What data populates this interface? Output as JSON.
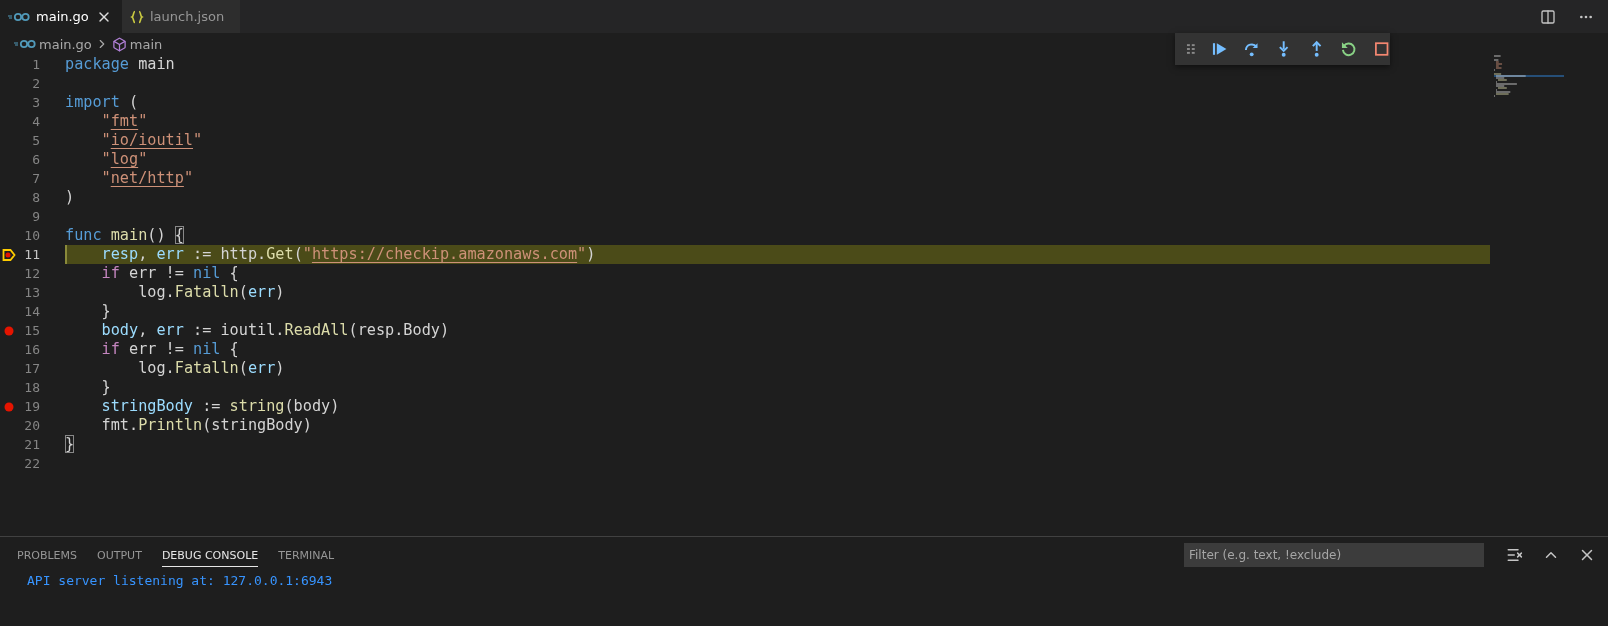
{
  "tabs": [
    {
      "label": "main.go",
      "kind": "go",
      "selected": true
    },
    {
      "label": "launch.json",
      "kind": "json",
      "selected": false
    }
  ],
  "breadcrumbs": [
    {
      "label": "main.go",
      "kind": "go"
    },
    {
      "label": "main",
      "kind": "symbol"
    }
  ],
  "debug_toolbar": [
    {
      "kind": "grip"
    },
    {
      "kind": "continue"
    },
    {
      "kind": "step_over"
    },
    {
      "kind": "step_into"
    },
    {
      "kind": "step_out"
    },
    {
      "kind": "restart"
    },
    {
      "kind": "stop"
    }
  ],
  "code_lines": [
    {
      "number": "1",
      "breakpoint": false,
      "current": false,
      "tokens": [
        {
          "text": "package",
          "kind": "keyword"
        },
        {
          "text": " main",
          "kind": "plain"
        }
      ]
    },
    {
      "number": "2",
      "breakpoint": false,
      "current": false
    },
    {
      "number": "3",
      "breakpoint": false,
      "current": false,
      "tokens": [
        {
          "text": "import",
          "kind": "keyword"
        },
        {
          "text": " (",
          "kind": "plain"
        }
      ]
    },
    {
      "number": "4",
      "breakpoint": false,
      "current": false,
      "tokens": [
        {
          "text": "    \"",
          "kind": "string"
        },
        {
          "text": "fmt",
          "kind": "link"
        },
        {
          "text": "\"",
          "kind": "string"
        }
      ]
    },
    {
      "number": "5",
      "breakpoint": false,
      "current": false,
      "tokens": [
        {
          "text": "    \"",
          "kind": "string"
        },
        {
          "text": "io/ioutil",
          "kind": "link"
        },
        {
          "text": "\"",
          "kind": "string"
        }
      ]
    },
    {
      "number": "6",
      "breakpoint": false,
      "current": false,
      "tokens": [
        {
          "text": "    \"",
          "kind": "string"
        },
        {
          "text": "log",
          "kind": "link"
        },
        {
          "text": "\"",
          "kind": "string"
        }
      ]
    },
    {
      "number": "7",
      "breakpoint": false,
      "current": false,
      "tokens": [
        {
          "text": "    \"",
          "kind": "string"
        },
        {
          "text": "net/http",
          "kind": "link"
        },
        {
          "text": "\"",
          "kind": "string"
        }
      ]
    },
    {
      "number": "8",
      "breakpoint": false,
      "current": false,
      "tokens": [
        {
          "text": ")",
          "kind": "plain"
        }
      ]
    },
    {
      "number": "9",
      "breakpoint": false,
      "current": false
    },
    {
      "number": "10",
      "breakpoint": false,
      "current": false,
      "tokens": [
        {
          "text": "func",
          "kind": "keyword"
        },
        {
          "text": " main",
          "kind": "function"
        },
        {
          "text": "() ",
          "kind": "plain"
        },
        {
          "text": "{",
          "kind": "bracket_match"
        }
      ]
    },
    {
      "number": "11",
      "breakpoint": true,
      "current": true,
      "tokens": [
        {
          "text": "    resp",
          "kind": "variable"
        },
        {
          "text": ", ",
          "kind": "plain"
        },
        {
          "text": "err",
          "kind": "variable"
        },
        {
          "text": " := http.",
          "kind": "plain"
        },
        {
          "text": "Get",
          "kind": "function"
        },
        {
          "text": "(",
          "kind": "plain"
        },
        {
          "text": "\"",
          "kind": "string"
        },
        {
          "text": "https://checkip.amazonaws.com",
          "kind": "link"
        },
        {
          "text": "\"",
          "kind": "string"
        },
        {
          "text": ")",
          "kind": "plain"
        }
      ]
    },
    {
      "number": "12",
      "breakpoint": false,
      "current": false,
      "tokens": [
        {
          "text": "    if",
          "kind": "control"
        },
        {
          "text": " err != ",
          "kind": "plain"
        },
        {
          "text": "nil",
          "kind": "keyword"
        },
        {
          "text": " {",
          "kind": "plain"
        }
      ]
    },
    {
      "number": "13",
      "breakpoint": false,
      "current": false,
      "tokens": [
        {
          "text": "        log.",
          "kind": "plain"
        },
        {
          "text": "Fatalln",
          "kind": "function"
        },
        {
          "text": "(",
          "kind": "plain"
        },
        {
          "text": "err",
          "kind": "variable"
        },
        {
          "text": ")",
          "kind": "plain"
        }
      ]
    },
    {
      "number": "14",
      "breakpoint": false,
      "current": false,
      "tokens": [
        {
          "text": "    }",
          "kind": "plain"
        }
      ]
    },
    {
      "number": "15",
      "breakpoint": true,
      "current": false,
      "tokens": [
        {
          "text": "    body",
          "kind": "variable"
        },
        {
          "text": ", ",
          "kind": "plain"
        },
        {
          "text": "err",
          "kind": "variable"
        },
        {
          "text": " := ioutil.",
          "kind": "plain"
        },
        {
          "text": "ReadAll",
          "kind": "function"
        },
        {
          "text": "(resp.Body)",
          "kind": "plain"
        }
      ]
    },
    {
      "number": "16",
      "breakpoint": false,
      "current": false,
      "tokens": [
        {
          "text": "    if",
          "kind": "control"
        },
        {
          "text": " err != ",
          "kind": "plain"
        },
        {
          "text": "nil",
          "kind": "keyword"
        },
        {
          "text": " {",
          "kind": "plain"
        }
      ]
    },
    {
      "number": "17",
      "breakpoint": false,
      "current": false,
      "tokens": [
        {
          "text": "        log.",
          "kind": "plain"
        },
        {
          "text": "Fatalln",
          "kind": "function"
        },
        {
          "text": "(",
          "kind": "plain"
        },
        {
          "text": "err",
          "kind": "variable"
        },
        {
          "text": ")",
          "kind": "plain"
        }
      ]
    },
    {
      "number": "18",
      "breakpoint": false,
      "current": false,
      "tokens": [
        {
          "text": "    }",
          "kind": "plain"
        }
      ]
    },
    {
      "number": "19",
      "breakpoint": true,
      "current": false,
      "tokens": [
        {
          "text": "    stringBody",
          "kind": "variable"
        },
        {
          "text": " := ",
          "kind": "plain"
        },
        {
          "text": "string",
          "kind": "function"
        },
        {
          "text": "(body)",
          "kind": "plain"
        }
      ]
    },
    {
      "number": "20",
      "breakpoint": false,
      "current": false,
      "tokens": [
        {
          "text": "    fmt.",
          "kind": "plain"
        },
        {
          "text": "Println",
          "kind": "function"
        },
        {
          "text": "(stringBody)",
          "kind": "plain"
        }
      ]
    },
    {
      "number": "21",
      "breakpoint": false,
      "current": false,
      "tokens": [
        {
          "text": "}",
          "kind": "bracket_match"
        }
      ]
    },
    {
      "number": "22",
      "breakpoint": false,
      "current": false
    }
  ],
  "panel": {
    "tabs": [
      {
        "label": "PROBLEMS",
        "selected": false
      },
      {
        "label": "OUTPUT",
        "selected": false
      },
      {
        "label": "DEBUG CONSOLE",
        "selected": true
      },
      {
        "label": "TERMINAL",
        "selected": false
      }
    ],
    "filter": {
      "placeholder": "Filter (e.g. text, !exclude)"
    },
    "console_lines": [
      "API server listening at: 127.0.0.1:6943"
    ]
  }
}
